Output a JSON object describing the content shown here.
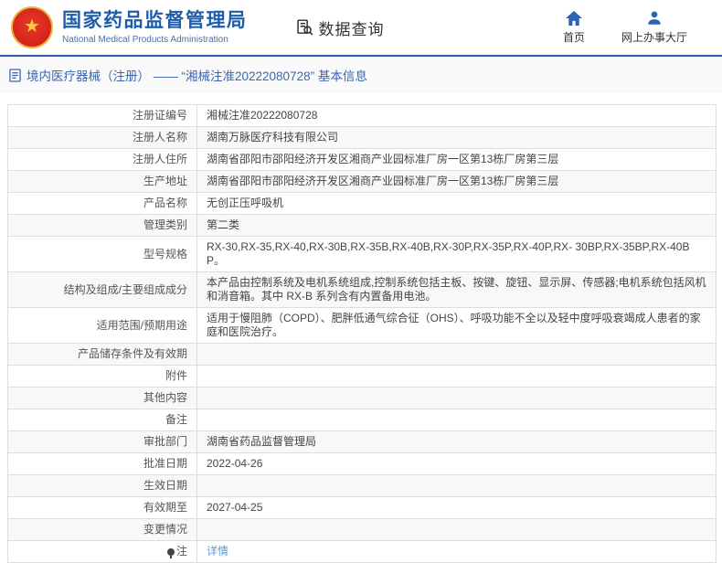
{
  "header": {
    "agency_name_cn": "国家药品监督管理局",
    "agency_name_en": "National Medical Products Administration",
    "section_title": "数据查询",
    "nav": {
      "home": "首页",
      "hall": "网上办事大厅"
    }
  },
  "breadcrumb": {
    "text": "境内医疗器械（注册） —— “湘械注准20222080728” 基本信息"
  },
  "detail_table": {
    "rows": [
      {
        "label": "注册证编号",
        "value": "湘械注准20222080728"
      },
      {
        "label": "注册人名称",
        "value": "湖南万脉医疗科技有限公司"
      },
      {
        "label": "注册人住所",
        "value": "湖南省邵阳市邵阳经济开发区湘商产业园标准厂房一区第13栋厂房第三层"
      },
      {
        "label": "生产地址",
        "value": "湖南省邵阳市邵阳经济开发区湘商产业园标准厂房一区第13栋厂房第三层"
      },
      {
        "label": "产品名称",
        "value": "无创正压呼吸机"
      },
      {
        "label": "管理类别",
        "value": "第二类"
      },
      {
        "label": "型号规格",
        "value": "RX-30,RX-35,RX-40,RX-30B,RX-35B,RX-40B,RX-30P,RX-35P,RX-40P,RX- 30BP,RX-35BP,RX-40BP。"
      },
      {
        "label": "结构及组成/主要组成成分",
        "value": "本产品由控制系统及电机系统组成,控制系统包括主板、按键、旋钮、显示屏、传感器;电机系统包括风机和消音箱。其中 RX-B 系列含有内置备用电池。"
      },
      {
        "label": "适用范围/预期用途",
        "value": "适用于慢阻肺（COPD）、肥胖低通气综合征（OHS）、呼吸功能不全以及轻中度呼吸衰竭成人患者的家庭和医院治疗。"
      },
      {
        "label": "产品储存条件及有效期",
        "value": ""
      },
      {
        "label": "附件",
        "value": ""
      },
      {
        "label": "其他内容",
        "value": ""
      },
      {
        "label": "备注",
        "value": ""
      },
      {
        "label": "审批部门",
        "value": "湖南省药品监督管理局"
      },
      {
        "label": "批准日期",
        "value": "2022-04-26"
      },
      {
        "label": "生效日期",
        "value": ""
      },
      {
        "label": "有效期至",
        "value": "2027-04-25"
      },
      {
        "label": "变更情况",
        "value": ""
      },
      {
        "label": "注",
        "value": "详情",
        "link": true,
        "label_icon": "note-icon"
      }
    ]
  },
  "colors": {
    "brand_blue": "#1f5cab",
    "header_line_blue": "#2a5caa",
    "link_blue": "#5b9bd5",
    "emblem_red": "#d8261c",
    "emblem_gold": "#f6c94a"
  }
}
